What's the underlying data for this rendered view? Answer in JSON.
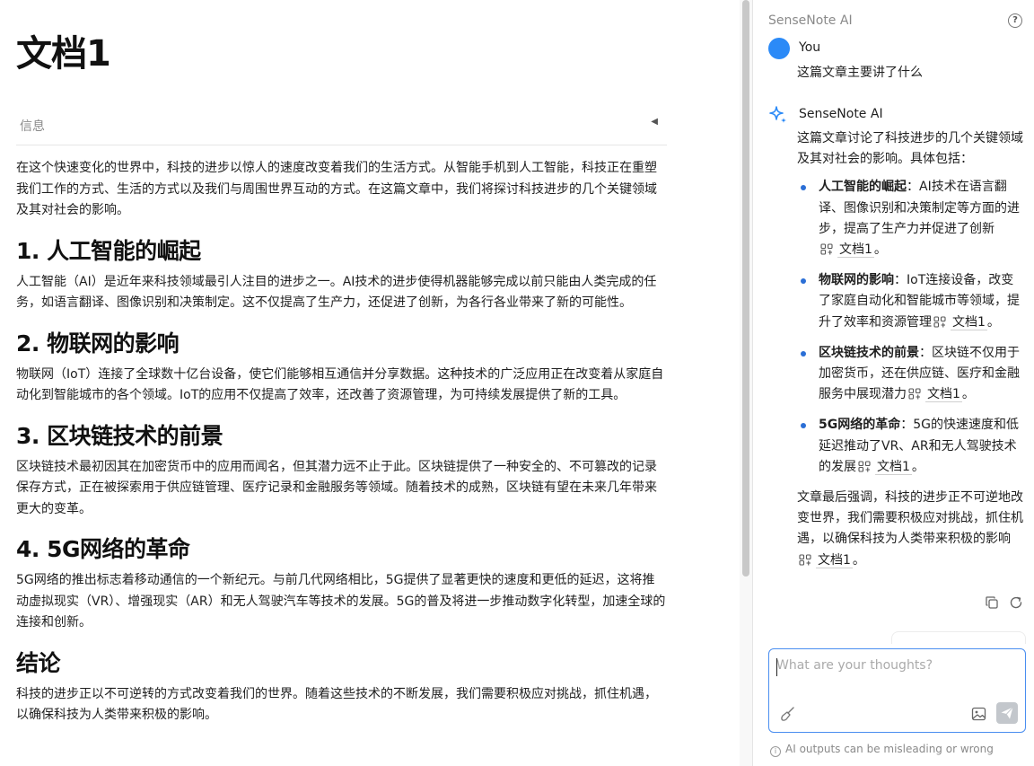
{
  "document": {
    "title": "文档1",
    "info_label": "信息",
    "intro": "在这个快速变化的世界中，科技的进步以惊人的速度改变着我们的生活方式。从智能手机到人工智能，科技正在重塑我们工作的方式、生活的方式以及我们与周围世界互动的方式。在这篇文章中，我们将探讨科技进步的几个关键领域及其对社会的影响。",
    "sections": [
      {
        "heading": "1. 人工智能的崛起",
        "body": "人工智能（AI）是近年来科技领域最引人注目的进步之一。AI技术的进步使得机器能够完成以前只能由人类完成的任务，如语言翻译、图像识别和决策制定。这不仅提高了生产力，还促进了创新，为各行各业带来了新的可能性。"
      },
      {
        "heading": "2. 物联网的影响",
        "body": "物联网（IoT）连接了全球数十亿台设备，使它们能够相互通信并分享数据。这种技术的广泛应用正在改变着从家庭自动化到智能城市的各个领域。IoT的应用不仅提高了效率，还改善了资源管理，为可持续发展提供了新的工具。"
      },
      {
        "heading": "3. 区块链技术的前景",
        "body": "区块链技术最初因其在加密货币中的应用而闻名，但其潜力远不止于此。区块链提供了一种安全的、不可篡改的记录保存方式，正在被探索用于供应链管理、医疗记录和金融服务等领域。随着技术的成熟，区块链有望在未来几年带来更大的变革。"
      },
      {
        "heading": "4. 5G网络的革命",
        "body": "5G网络的推出标志着移动通信的一个新纪元。与前几代网络相比，5G提供了显著更快的速度和更低的延迟，这将推动虚拟现实（VR）、增强现实（AR）和无人驾驶汽车等技术的发展。5G的普及将进一步推动数字化转型，加速全球的连接和创新。"
      },
      {
        "heading": "结论",
        "body": "科技的进步正以不可逆转的方式改变着我们的世界。随着这些技术的不断发展，我们需要积极应对挑战，抓住机遇，以确保科技为人类带来积极的影响。"
      }
    ]
  },
  "ai_panel": {
    "header": "SenseNote AI",
    "user_name": "You",
    "user_message": "这篇文章主要讲了什么",
    "assistant_name": "SenseNote AI",
    "answer_intro": "这篇文章讨论了科技进步的几个关键领域及其对社会的影响。具体包括：",
    "points": [
      {
        "title": "人工智能的崛起",
        "text": "：AI技术在语言翻译、图像识别和决策制定等方面的进步，提高了生产力并促进了创新",
        "cite": "文档1",
        "end": "。"
      },
      {
        "title": "物联网的影响",
        "text": "：IoT连接设备，改变了家庭自动化和智能城市等领域，提升了效率和资源管理",
        "cite": "文档1",
        "end": "。"
      },
      {
        "title": "区块链技术的前景",
        "text": "：区块链不仅用于加密货币，还在供应链、医疗和金融服务中展现潜力",
        "cite": "文档1",
        "end": "。"
      },
      {
        "title": "5G网络的革命",
        "text": "：5G的快速速度和低延迟推动了VR、AR和无人驾驶技术的发展",
        "cite": "文档1",
        "end": "。"
      }
    ],
    "closing": "文章最后强调，科技的进步正不可逆地改变世界，我们需要积极应对挑战，抓住机遇，以确保科技为人类带来积极的影响",
    "closing_cite": "文档1",
    "closing_end": "。",
    "input_placeholder": "What are your thoughts?",
    "disclaimer": "AI outputs can be misleading or wrong"
  },
  "colors": {
    "accent": "#4a8ef0",
    "avatar": "#2b8af7",
    "bullet": "#2b6fd6",
    "send_disabled": "#c3c7cc"
  },
  "icons": [
    "help-icon",
    "sparkle-icon",
    "citation-icon",
    "copy-icon",
    "refresh-icon",
    "broom-icon",
    "image-icon",
    "send-icon",
    "info-icon",
    "collapse-arrow-icon"
  ]
}
